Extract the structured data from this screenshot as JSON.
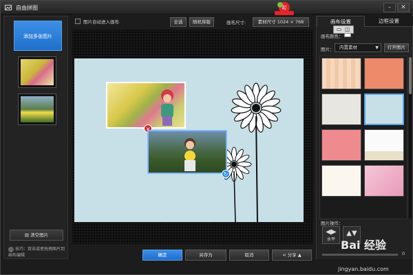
{
  "titlebar": {
    "title": "自由拼图"
  },
  "left_panel": {
    "add_button": "添加多张图片",
    "clear_button": "清空图片",
    "tip": "技巧：双击或者拖拽图片到画布编辑"
  },
  "toolbar": {
    "auto_canvas_label": "图片自动进入画布",
    "select_all": "全选",
    "random_layout": "随机排版",
    "canvas_size_label": "画布尺寸:",
    "size_preset": "素材尺寸",
    "width": "1024",
    "times": "×",
    "height": "768"
  },
  "bottom": {
    "confirm": "确定",
    "save_as": "另存为",
    "cancel": "取消",
    "share": "分享"
  },
  "right_panel": {
    "tab_canvas": "画布设置",
    "tab_border": "边框设置",
    "canvas_color_label": "画布颜色：",
    "image_label": "图片：",
    "image_select": "内置素材",
    "open_image": "打开图片",
    "photo_ops_label": "图片操作：",
    "flip_h": "水平",
    "slider_value": "0"
  },
  "watermark": {
    "text": "Bai 经验",
    "url": "jingyan.baidu.com"
  },
  "colors": {
    "accent": "#1f6fcc",
    "canvas_bg": "#c7e0e8",
    "delete": "#d9252b"
  }
}
